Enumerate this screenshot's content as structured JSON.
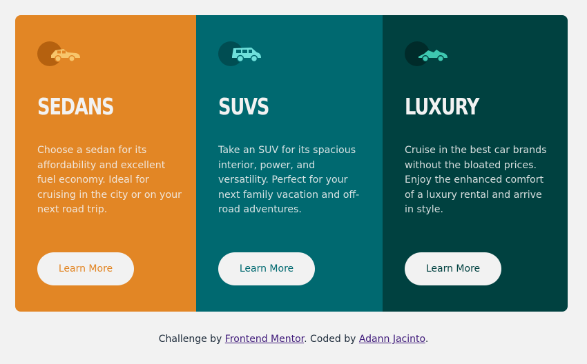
{
  "cards": [
    {
      "title": "SEDANS",
      "icon": "sedan-car-icon",
      "description": "Choose a sedan for its affordability and excellent fuel economy. Ideal for cruising in the city or on your next road trip.",
      "button": "Learn More",
      "color": "#e28625"
    },
    {
      "title": "SUVS",
      "icon": "suv-car-icon",
      "description": "Take an SUV for its spacious interior, power, and versatility. Perfect for your next family vacation and off-road adventures.",
      "button": "Learn More",
      "color": "#006970"
    },
    {
      "title": "LUXURY",
      "icon": "luxury-car-icon",
      "description": "Cruise in the best car brands without the bloated prices. Enjoy the enhanced comfort of a luxury rental and arrive in style.",
      "button": "Learn More",
      "color": "#004140"
    }
  ],
  "footer": {
    "prefix": "Challenge by ",
    "link1": "Frontend Mentor",
    "middle": ". Coded by ",
    "link2": "Adann Jacinto",
    "suffix": "."
  }
}
